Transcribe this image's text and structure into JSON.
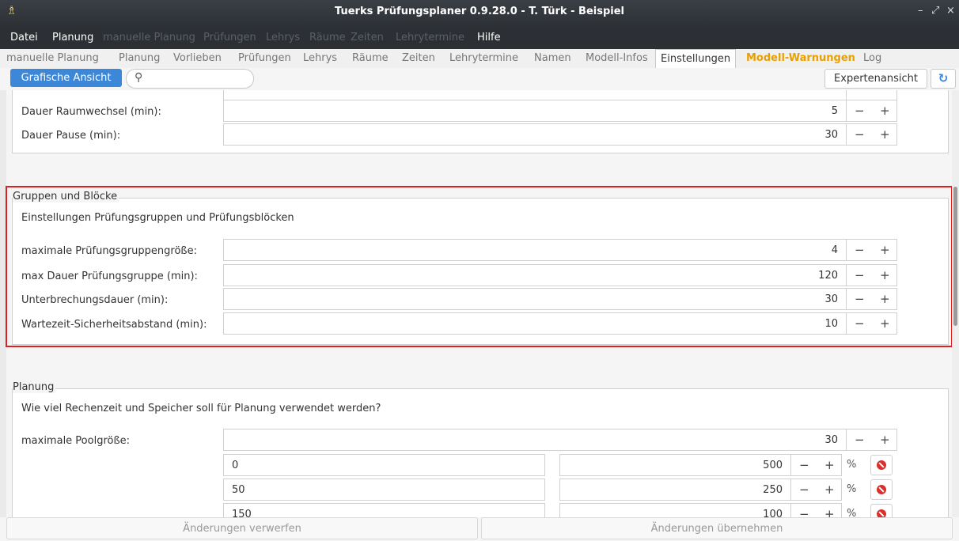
{
  "window": {
    "title": "Tuerks Prüfungsplaner 0.9.28.0 - T. Türk - Beispiel",
    "controls": [
      "–",
      "⤢",
      "×"
    ]
  },
  "menu": [
    {
      "label": "Datei",
      "enabled": true
    },
    {
      "label": "Planung",
      "enabled": true
    },
    {
      "label": "manuelle Planung",
      "enabled": false
    },
    {
      "label": "Prüfungen",
      "enabled": false
    },
    {
      "label": "Lehrys",
      "enabled": false
    },
    {
      "label": "Räume",
      "enabled": false
    },
    {
      "label": "Zeiten",
      "enabled": false
    },
    {
      "label": "Lehrytermine",
      "enabled": false
    },
    {
      "label": "Hilfe",
      "enabled": true
    }
  ],
  "tabs": [
    "manuelle Planung",
    "Planung",
    "Vorlieben",
    "Prüfungen",
    "Lehrys",
    "Räume",
    "Zeiten",
    "Lehrytermine",
    "Namen",
    "Modell-Infos",
    "Einstellungen",
    "Modell-Warnungen",
    "Log"
  ],
  "active_tab": "Einstellungen",
  "toolbar": {
    "grafische": "Grafische Ansicht",
    "search_placeholder": "",
    "expert": "Expertenansicht"
  },
  "top_rows": [
    {
      "label": "Dauer Raumwechsel (min):",
      "value": "5"
    },
    {
      "label": "Dauer Pause (min):",
      "value": "30"
    }
  ],
  "groups": {
    "title": "Gruppen und Blöcke",
    "description": "Einstellungen Prüfungsgruppen und Prüfungsblöcken",
    "rows": [
      {
        "label": "maximale Prüfungsgruppengröße:",
        "value": "4"
      },
      {
        "label": "max Dauer Prüfungsgruppe (min):",
        "value": "120"
      },
      {
        "label": "Unterbrechungsdauer (min):",
        "value": "30"
      },
      {
        "label": "Wartezeit-Sicherheitsabstand (min):",
        "value": "10"
      }
    ]
  },
  "planung": {
    "title": "Planung",
    "description": "Wie viel Rechenzeit und Speicher soll für Planung verwendet werden?",
    "pool_label": "maximale Poolgröße:",
    "pool_value": "30",
    "pool_rows": [
      {
        "threshold": "0",
        "size": "500",
        "unit": "%"
      },
      {
        "threshold": "50",
        "size": "250",
        "unit": "%"
      },
      {
        "threshold": "150",
        "size": "100",
        "unit": "%"
      }
    ]
  },
  "spin": {
    "minus": "−",
    "plus": "+"
  },
  "bottom": {
    "discard": "Änderungen verwerfen",
    "apply": "Änderungen übernehmen"
  },
  "colors": {
    "accent": "#3d87d9",
    "warning": "#e8a000",
    "highlight": "#e02020",
    "delete": "#d9302c"
  }
}
